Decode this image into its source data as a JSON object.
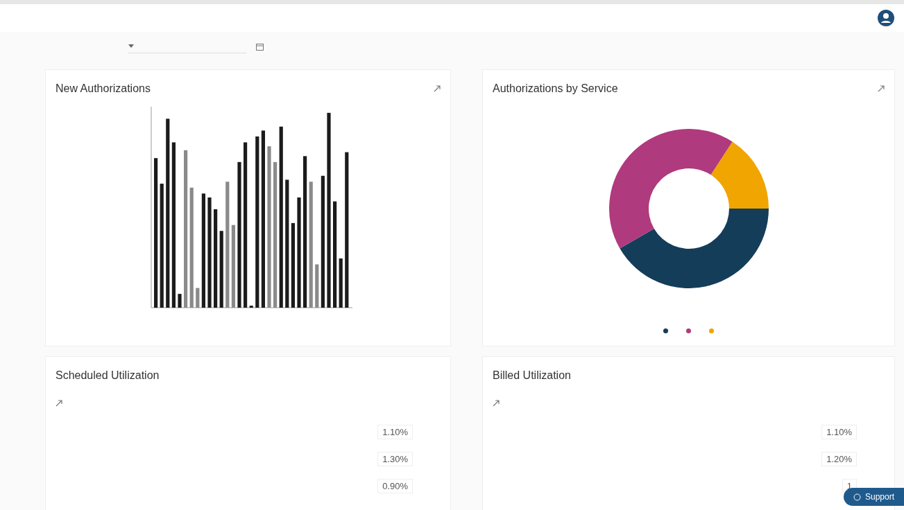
{
  "cards": [
    {
      "kind": "bars",
      "title": "New Authorizations"
    },
    {
      "kind": "donut",
      "title": "Authorizations by Service",
      "legend": [
        {
          "color": "#143d59"
        },
        {
          "color": "#b03a7e"
        },
        {
          "color": "#f0a500"
        }
      ]
    },
    {
      "kind": "list",
      "title": "Scheduled Utilization",
      "rows": [
        {
          "value": "1.10%"
        },
        {
          "value": "1.30%"
        },
        {
          "value": "0.90%"
        }
      ]
    },
    {
      "kind": "list",
      "title": "Billed Utilization",
      "rows": [
        {
          "value": "1.10%"
        },
        {
          "value": "1.20%"
        },
        {
          "value": "1"
        }
      ]
    }
  ],
  "support_button": {
    "label": "Support"
  }
}
